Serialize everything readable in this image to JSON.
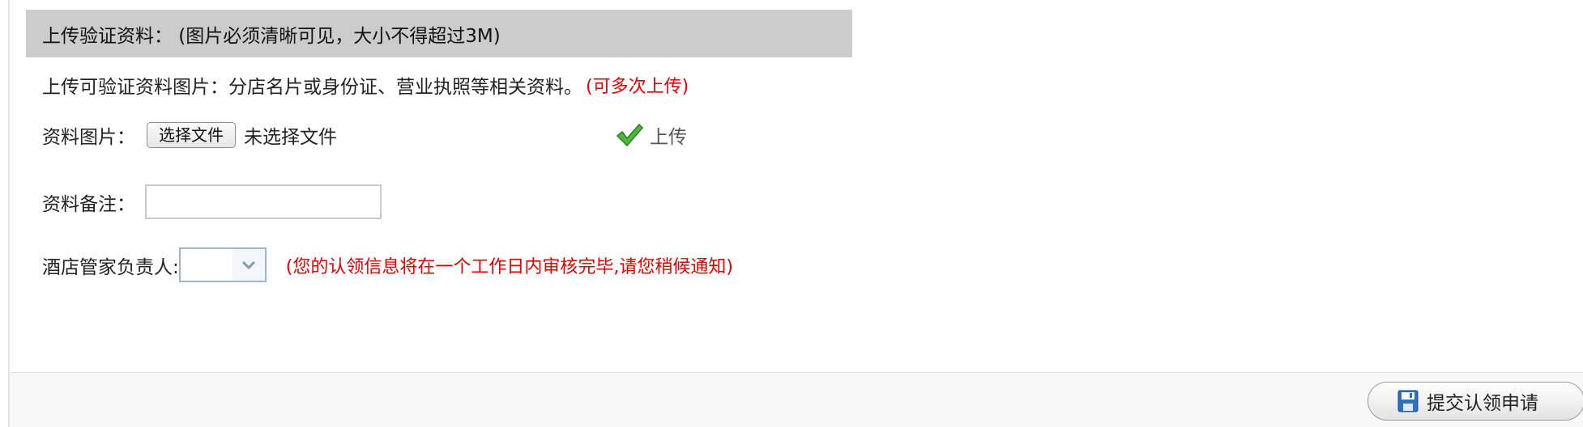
{
  "section": {
    "title": "上传验证资料：  (图片必须清晰可见，大小不得超过3M)"
  },
  "intro": {
    "text": "上传可验证资料图片：分店名片或身份证、营业执照等相关资料。",
    "note": "(可多次上传)"
  },
  "file_row": {
    "label": "资料图片：",
    "button_label": "选择文件",
    "status": "未选择文件",
    "upload_label": "上传"
  },
  "remark_row": {
    "label": "资料备注：",
    "value": ""
  },
  "manager_row": {
    "label": "酒店管家负责人:",
    "selected": "",
    "notice": "(您的认领信息将在一个工作日内审核完毕,请您稍候通知)"
  },
  "footer": {
    "submit_label": "提交认领申请"
  },
  "colors": {
    "header_bg": "#cccccc",
    "notice_red": "#e60000",
    "check_green": "#3aa32c",
    "disk_blue": "#2f6fc0"
  }
}
